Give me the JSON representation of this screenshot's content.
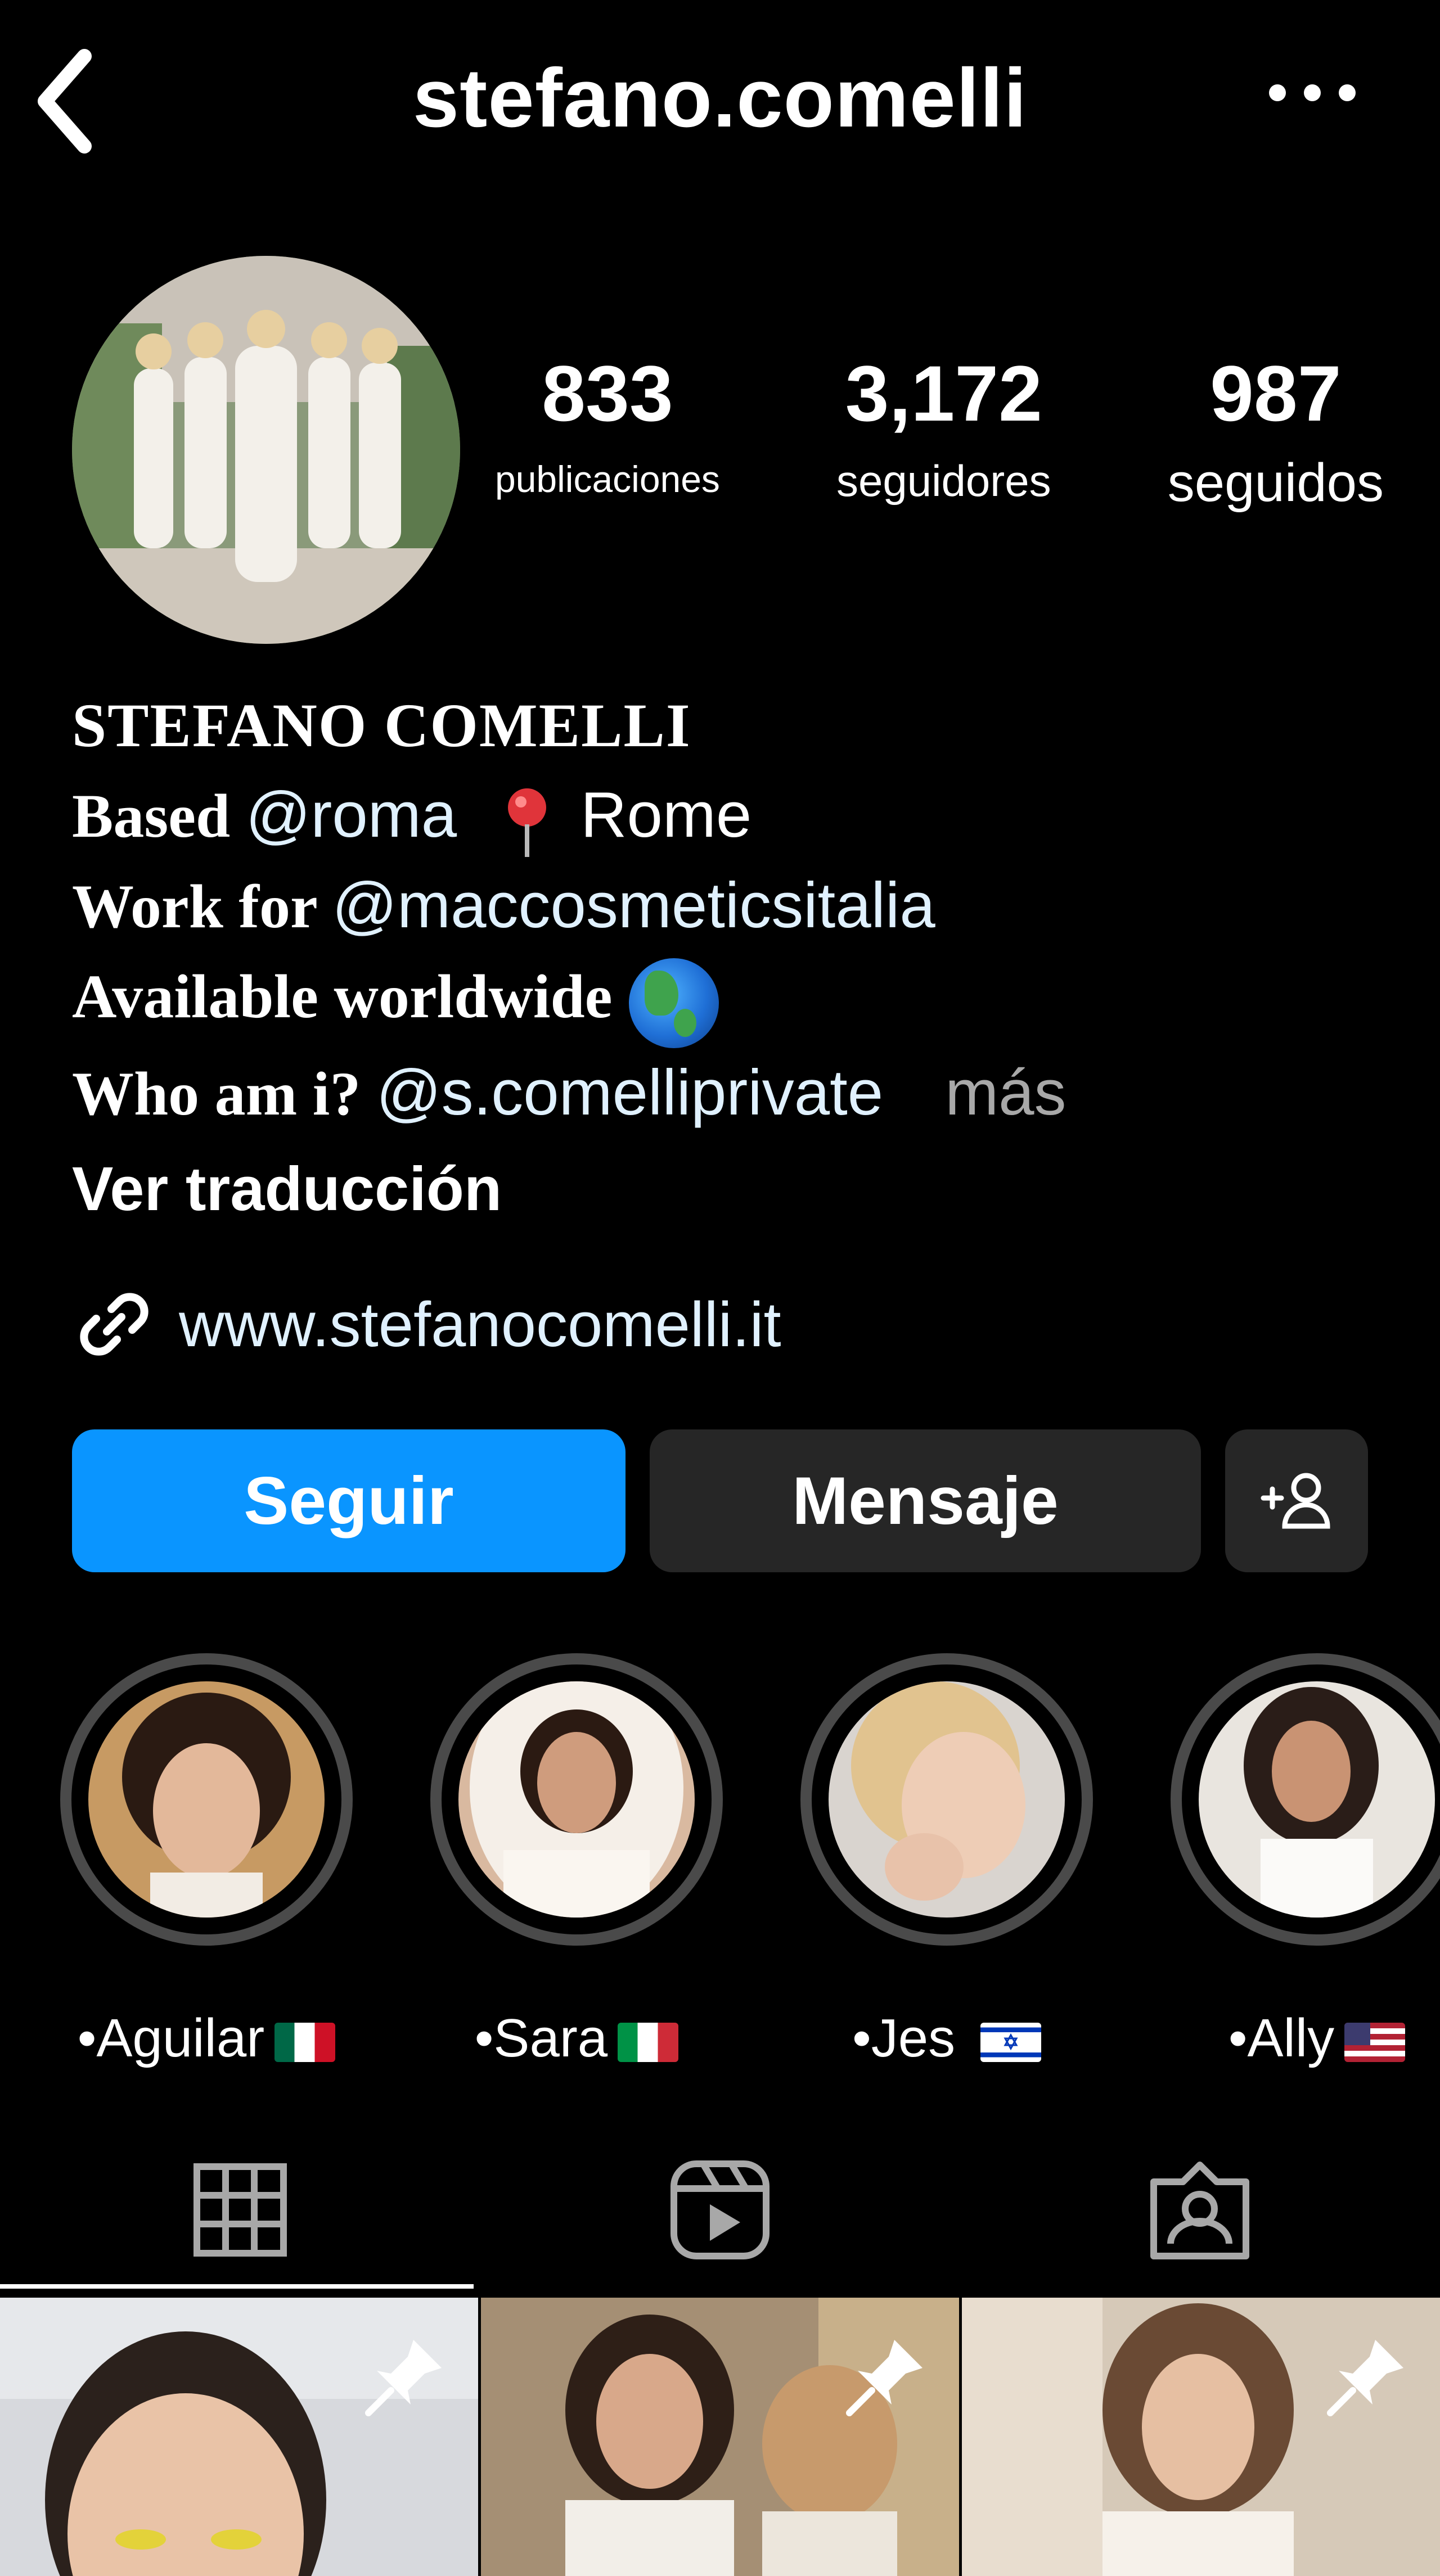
{
  "header": {
    "username": "stefano.comelli",
    "back_icon": "chevron-left-icon",
    "more_icon": "more-horizontal-icon"
  },
  "stats": {
    "posts": {
      "value": "833",
      "label": "publicaciones"
    },
    "followers": {
      "value": "3,172",
      "label": "seguidores"
    },
    "following": {
      "value": "987",
      "label": "seguidos"
    }
  },
  "bio": {
    "name": "STEFANO COMELLI",
    "line1_prefix": "Based ",
    "line1_mention": "@roma",
    "line1_location": "Rome",
    "line2_prefix": "Work for ",
    "line2_mention": "@maccosmeticsitalia",
    "line3_text": "Available worldwide",
    "line4_prefix": "Who am i? ",
    "line4_mention": "@s.comelliprivate",
    "more": "más",
    "translate": "Ver traducción"
  },
  "link": {
    "url": "www.stefanocomelli.it",
    "icon": "link-icon"
  },
  "buttons": {
    "follow": "Seguir",
    "message": "Mensaje",
    "add_user_icon": "add-user-icon"
  },
  "highlights": [
    {
      "label": "•Aguilar",
      "flag": "mexico"
    },
    {
      "label": "•Sara",
      "flag": "italy"
    },
    {
      "label": "•Jes ",
      "flag": "israel"
    },
    {
      "label": "•Ally",
      "flag": "usa"
    }
  ],
  "tabs": [
    {
      "name": "posts-grid",
      "icon": "grid-icon",
      "active": true
    },
    {
      "name": "reels",
      "icon": "reels-icon",
      "active": false
    },
    {
      "name": "tagged",
      "icon": "tagged-icon",
      "active": false
    }
  ],
  "colors": {
    "background": "#000000",
    "primary_button": "#0a95ff",
    "secondary_button": "#262626",
    "mention": "#e0f1ff",
    "muted": "#a8a8a8"
  }
}
